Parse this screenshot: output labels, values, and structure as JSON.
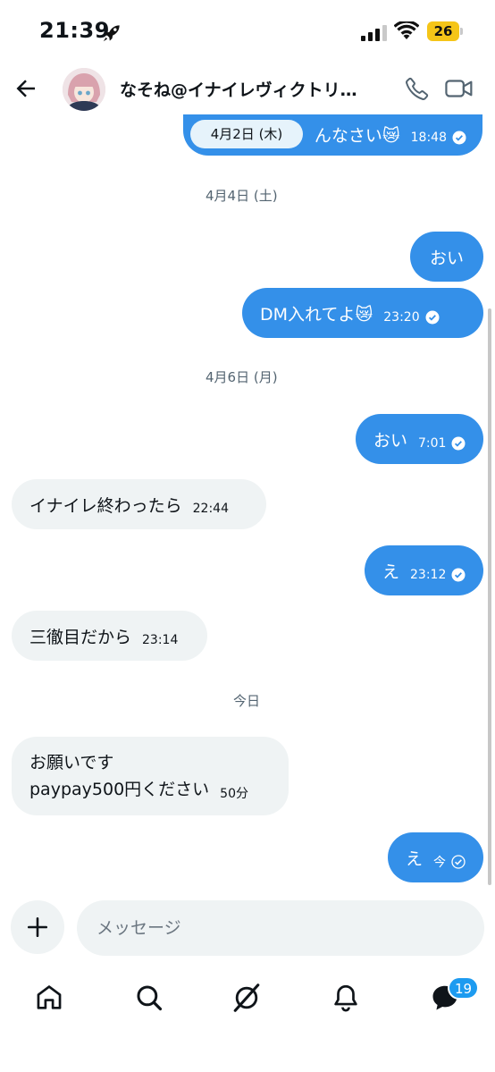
{
  "status_bar": {
    "time": "21:39",
    "battery": "26",
    "icons": [
      "rocket-icon",
      "signal-icon",
      "wifi-icon",
      "battery-icon"
    ]
  },
  "header": {
    "contact_name": "なそね@イナイレヴィクトリ…",
    "icons": [
      "back-arrow-icon",
      "avatar",
      "phone-icon",
      "video-camera-icon"
    ]
  },
  "chat": {
    "partial_message": {
      "text": "んなさい😿",
      "time": "18:48"
    },
    "sticky_date": "4月2日 (木)",
    "dates": [
      "4月4日 (土)",
      "4月6日 (月)",
      "今日"
    ],
    "messages": [
      {
        "direction": "out",
        "text": "おい",
        "time": ""
      },
      {
        "direction": "out",
        "text": "DM入れてよ😿",
        "time": "23:20"
      },
      {
        "direction": "out",
        "text": "おい",
        "time": "7:01"
      },
      {
        "direction": "in",
        "text": "イナイレ終わったら",
        "time": "22:44"
      },
      {
        "direction": "out",
        "text": "え",
        "time": "23:12"
      },
      {
        "direction": "in",
        "text": "三徹目だから",
        "time": "23:14"
      },
      {
        "direction": "in",
        "line1": "お願いです",
        "line2": "paypay500円ください",
        "time": "50分"
      },
      {
        "direction": "out",
        "text": "え",
        "time": "今"
      }
    ]
  },
  "composer": {
    "placeholder": "メッセージ"
  },
  "bottom_nav": {
    "items": [
      "home-icon",
      "search-icon",
      "grok-icon",
      "notifications-bell-icon",
      "messages-icon"
    ],
    "messages_badge": "19"
  },
  "colors": {
    "outgoing_bubble": "#3490e9",
    "incoming_bubble": "#eff3f4",
    "badge": "#1d9bf0",
    "battery": "#f5c518"
  }
}
